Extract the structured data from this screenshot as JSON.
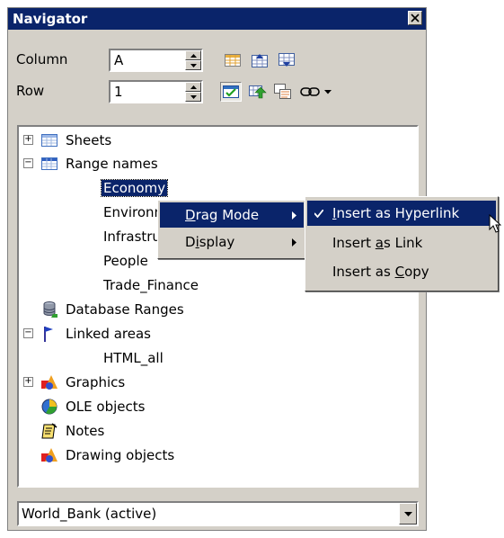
{
  "window": {
    "title": "Navigator"
  },
  "controls": {
    "column_label": "Column",
    "column_value": "A",
    "row_label": "Row",
    "row_value": "1"
  },
  "toolbar": {
    "icons": [
      "data-range-icon",
      "start-icon",
      "end-icon",
      "toggle-icon",
      "scenarios-icon",
      "drag-mode-icon",
      "link-icon"
    ]
  },
  "tree": {
    "sheets": "Sheets",
    "range_names": "Range names",
    "ranges": [
      "Economy",
      "Environm",
      "Infrastru",
      "People",
      "Trade_Finance"
    ],
    "database_ranges": "Database Ranges",
    "linked_areas": "Linked areas",
    "linked_child": "HTML_all",
    "graphics": "Graphics",
    "ole_objects": "OLE objects",
    "notes": "Notes",
    "drawing_objects": "Drawing objects"
  },
  "document_combo": {
    "value": "World_Bank (active)"
  },
  "context_menu": {
    "items": [
      {
        "pre": "",
        "u": "D",
        "post": "rag Mode"
      },
      {
        "pre": "D",
        "u": "i",
        "post": "splay"
      }
    ]
  },
  "submenu": {
    "items": [
      {
        "pre": "",
        "u": "I",
        "post": "nsert as Hyperlink",
        "checked": true
      },
      {
        "pre": "Insert ",
        "u": "a",
        "post": "s Link",
        "checked": false
      },
      {
        "pre": "Insert as ",
        "u": "C",
        "post": "opy",
        "checked": false
      }
    ]
  }
}
